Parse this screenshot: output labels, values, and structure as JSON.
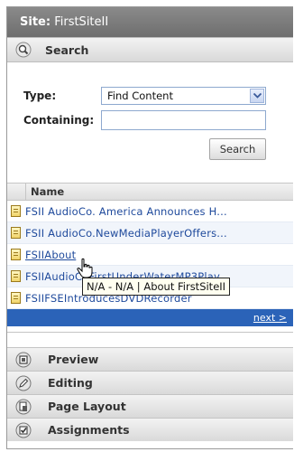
{
  "site": {
    "label": "Site:",
    "name": "FirstSiteII"
  },
  "sections": {
    "search": {
      "label": "Search"
    },
    "preview": {
      "label": "Preview"
    },
    "editing": {
      "label": "Editing"
    },
    "page_layout": {
      "label": "Page Layout"
    },
    "assignments": {
      "label": "Assignments"
    }
  },
  "search_form": {
    "type_label": "Type:",
    "type_value": "Find Content",
    "containing_label": "Containing:",
    "containing_value": "",
    "button_label": "Search"
  },
  "results": {
    "column_header": "Name",
    "rows": [
      "FSII AudioCo. America Announces H...",
      "FSII AudioCo.NewMediaPlayerOffers...",
      "FSIIAbout",
      "FSIIAudioCoFirstUnderWaterMP3Play...",
      "FSIIFSEIntroducesDVDRecorder"
    ],
    "next_label": "next >"
  },
  "tooltip": {
    "text": "N/A - N/A | About FirstSiteII"
  },
  "icons": [
    "magnifier-icon",
    "chevron-down-icon",
    "document-icon",
    "preview-icon",
    "pencil-icon",
    "page-layout-icon",
    "checkbox-icon",
    "hand-cursor-icon"
  ]
}
